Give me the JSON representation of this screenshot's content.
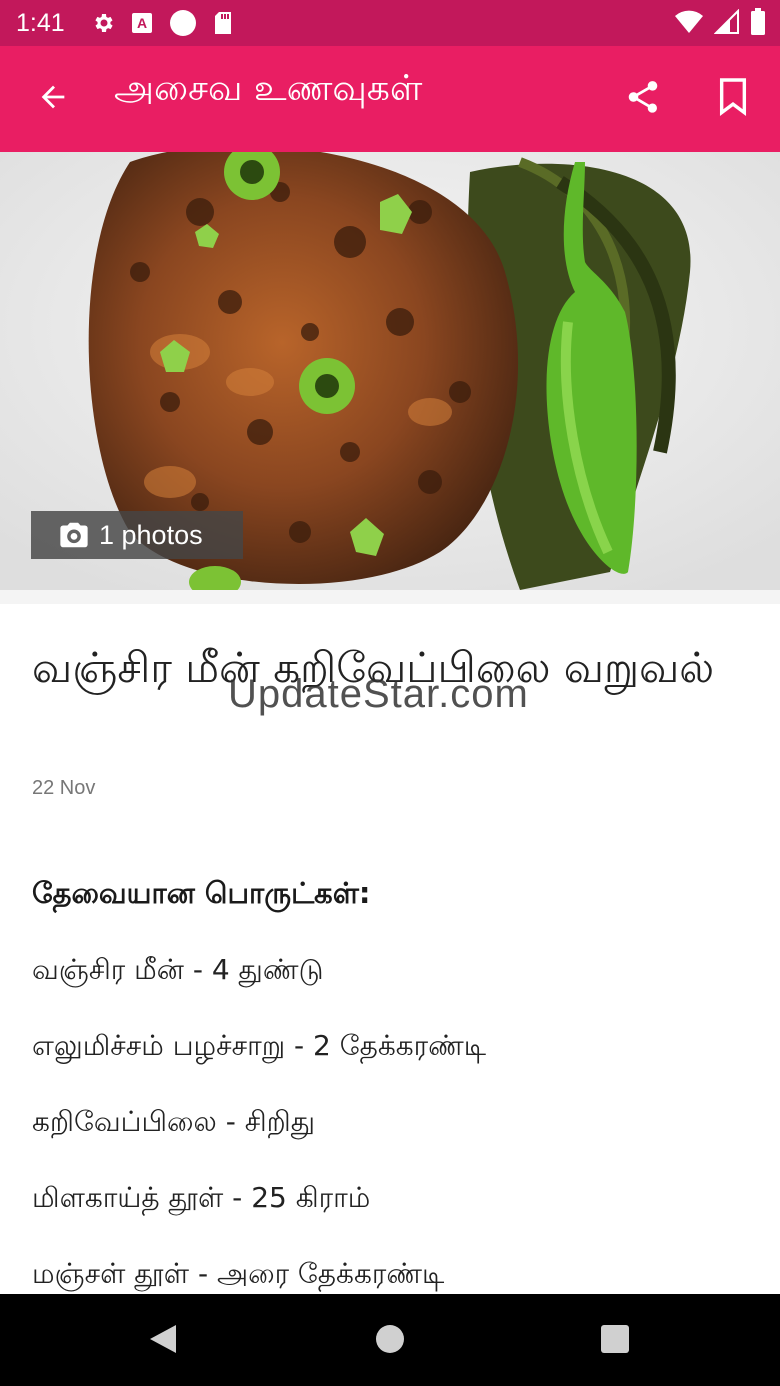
{
  "status_bar": {
    "time": "1:41",
    "icons_left": [
      "gear-icon",
      "a-letter-icon",
      "circle-icon",
      "sd-card-icon"
    ],
    "icons_right": [
      "wifi-icon",
      "signal-icon",
      "battery-icon"
    ]
  },
  "app_bar": {
    "title": "அசைவ உணவுகள்",
    "background": "#e91e63",
    "status_background": "#c2185b",
    "back_icon": "arrow-left-icon",
    "share_icon": "share-icon",
    "bookmark_icon": "bookmark-icon"
  },
  "hero": {
    "photo_count_label": "1 photos",
    "camera_icon": "camera-icon"
  },
  "article": {
    "title": "வஞ்சிர மீன் கறிவேப்பிலை வறுவல்",
    "date": "22 Nov",
    "watermark": "UpdateStar.com",
    "section_heading": "தேவையான பொருட்கள்:",
    "ingredients": [
      "வஞ்சிர மீன் - 4 துண்டு",
      "எலுமிச்சம் பழச்சாறு - 2 தேக்கரண்டி",
      "கறிவேப்பிலை - சிறிது",
      "மிளகாய்த் தூள் - 25 கிராம்",
      "மஞ்சள் தூள் - அரை தேக்கரண்டி"
    ]
  },
  "nav_bar": {
    "buttons": [
      "back-triangle-icon",
      "home-circle-icon",
      "recents-square-icon"
    ]
  }
}
